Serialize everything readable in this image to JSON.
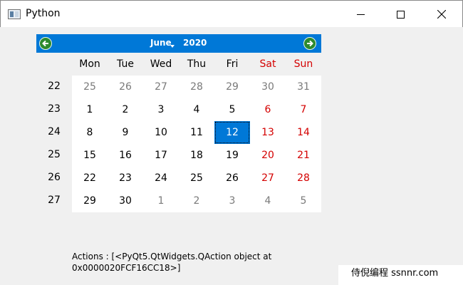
{
  "window": {
    "title": "Python",
    "icon": "app-window-icon"
  },
  "calendar": {
    "month": "June",
    "year": "2020",
    "prev_icon": "left-arrow-icon",
    "next_icon": "right-arrow-icon",
    "day_headers": [
      "Mon",
      "Tue",
      "Wed",
      "Thu",
      "Fri",
      "Sat",
      "Sun"
    ],
    "weeks": [
      {
        "num": "22",
        "days": [
          "25",
          "26",
          "27",
          "28",
          "29",
          "30",
          "31"
        ]
      },
      {
        "num": "23",
        "days": [
          "1",
          "2",
          "3",
          "4",
          "5",
          "6",
          "7"
        ]
      },
      {
        "num": "24",
        "days": [
          "8",
          "9",
          "10",
          "11",
          "12",
          "13",
          "14"
        ]
      },
      {
        "num": "25",
        "days": [
          "15",
          "16",
          "17",
          "18",
          "19",
          "20",
          "21"
        ]
      },
      {
        "num": "26",
        "days": [
          "22",
          "23",
          "24",
          "25",
          "26",
          "27",
          "28"
        ]
      },
      {
        "num": "27",
        "days": [
          "29",
          "30",
          "1",
          "2",
          "3",
          "4",
          "5"
        ]
      }
    ],
    "selected_day": "12",
    "weekend_color": "#d40000",
    "accent_color": "#0078d7"
  },
  "actions_text": {
    "line1": "Actions : [<PyQt5.QtWidgets.QAction object at",
    "line2": "0x0000020FCF16CC18>]"
  },
  "watermark": {
    "text": "侍倪编程 ssnnr.com"
  }
}
